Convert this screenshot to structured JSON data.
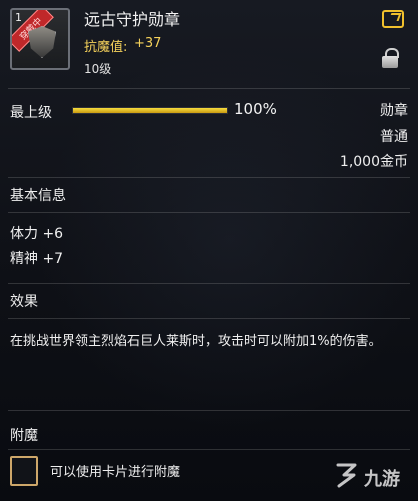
{
  "header": {
    "stack_count": "1",
    "equipped_tag": "穿戴中",
    "item_name": "远古守护勋章",
    "resist_label": "抗魔值:",
    "resist_value": "+37",
    "level": "10级",
    "icons": {
      "item": "medal-shield-icon",
      "share": "share-icon",
      "lock": "lock-icon"
    }
  },
  "upgrade": {
    "label": "最上级",
    "progress": 1.0,
    "progress_text": "100%"
  },
  "meta": {
    "type": "勋章",
    "grade": "普通",
    "price": "1,000金币"
  },
  "basic_info": {
    "title": "基本信息",
    "stats": [
      {
        "text": "体力 +6"
      },
      {
        "text": "精神 +7"
      }
    ]
  },
  "effect": {
    "title": "效果",
    "description": "在挑战世界领主烈焰石巨人莱斯时，攻击时可以附加1%的伤害。"
  },
  "enchant": {
    "title": "附魔",
    "hint": "可以使用卡片进行附魔",
    "icon": "card-slot-icon"
  },
  "watermark": {
    "text": "九游",
    "icon": "jiuyou-logo-icon"
  },
  "colors": {
    "accent_gold": "#f0c02d",
    "resist_yellow": "#f6d25b",
    "equipped_red": "#c0282a",
    "panel_bg": "#0f1117"
  }
}
